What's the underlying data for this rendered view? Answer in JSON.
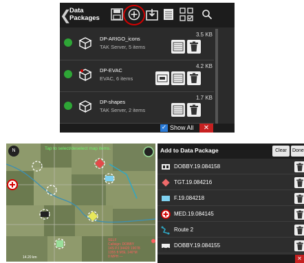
{
  "data_packages": {
    "title": "Data\nPackages",
    "back_glyph": "❮",
    "toolbar_icons": [
      "save-icon",
      "add-icon",
      "import-icon",
      "list-icon",
      "grid-select-icon",
      "search-icon"
    ],
    "packages": [
      {
        "name": "DP-ARIGO_icons",
        "subtitle": "TAK Server, 5 items",
        "size": "3.5 KB",
        "icon": "package-icon",
        "status_color": "#2ea636"
      },
      {
        "name": "DP-EVAC",
        "subtitle": "EVAC, 6 items",
        "size": "4.2 KB",
        "icon": "package-icon",
        "status_color": "#2ea636"
      },
      {
        "name": "DP-shapes",
        "subtitle": "TAK Server, 2 items",
        "size": "1.7 KB",
        "icon": "package-icon",
        "status_color": "#2ea636"
      }
    ],
    "show_all_label": "Show All",
    "show_all_checked": true,
    "close_glyph": "✕"
  },
  "map": {
    "hint": "Tap to select/deselect map items.",
    "compass_label": "N",
    "info_text": "SELF\nCallsign: DOBBY\n14S PJ 34420 19078\n1355 ft MSL  146°M\n0 MPH  ---",
    "scale_label": "14.20 km"
  },
  "add_to_package": {
    "title": "Add to Data Package",
    "clear_label": "Clear",
    "done_label": "Done",
    "items": [
      {
        "label": "DOBBY.19.084158",
        "icon": "vehicle-icon"
      },
      {
        "label": "TGT.19.084216",
        "icon": "diamond-icon"
      },
      {
        "label": "F.19.084218",
        "icon": "rectangle-icon"
      },
      {
        "label": "MED.19.084145",
        "icon": "medical-icon"
      },
      {
        "label": "Route 2",
        "icon": "route-icon"
      },
      {
        "label": "DOBBY.19.084155",
        "icon": "vehicle-icon"
      }
    ]
  },
  "colors": {
    "accent_red": "#d60000",
    "status_green": "#2ea636",
    "checkbox_blue": "#2a7ad6",
    "panel_dark": "#2b2b2b"
  }
}
